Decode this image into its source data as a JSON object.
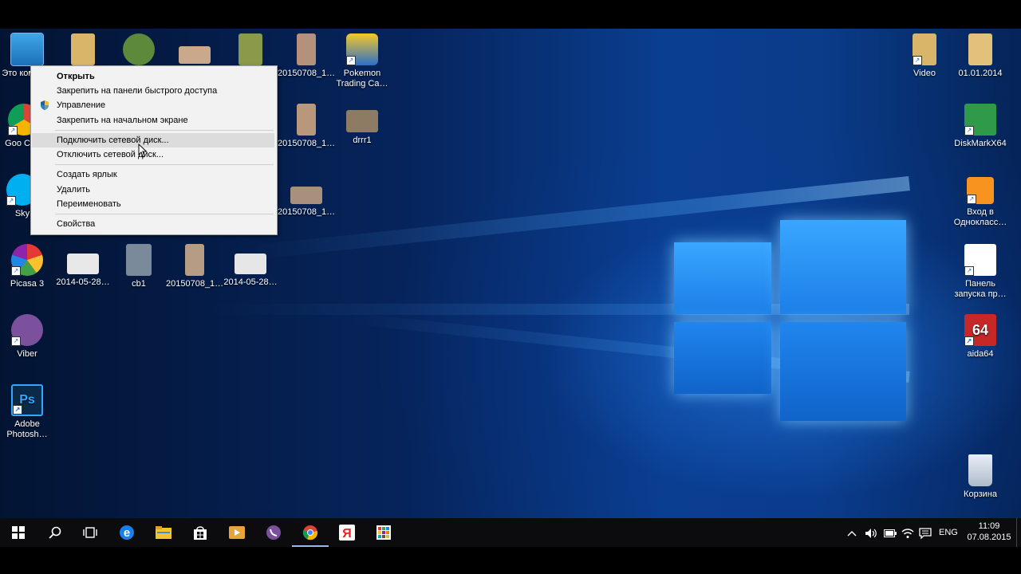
{
  "desktop": {
    "left_icons": [
      {
        "name": "this-pc-icon",
        "label": "Этот компьютер",
        "label_visible": "Это компь…",
        "type": "pc"
      },
      {
        "name": "chrome-desktop-icon",
        "label": "Google Chrome",
        "label_visible": "Goo Chro",
        "type": "chrome"
      },
      {
        "name": "skype-desktop-icon",
        "label": "Skype",
        "label_visible": "Sky",
        "type": "skype"
      },
      {
        "name": "picasa-desktop-icon",
        "label": "Picasa 3",
        "type": "picasa"
      },
      {
        "name": "viber-desktop-icon",
        "label": "Viber",
        "type": "viber"
      },
      {
        "name": "photoshop-desktop-icon",
        "label": "Adobe Photosh…",
        "type": "ps"
      }
    ],
    "file_icons": [
      {
        "label": "20150708_1…"
      },
      {
        "label": "Pokemon Trading Ca…"
      },
      {
        "label": "20150708_1…"
      },
      {
        "label": "drrr1"
      },
      {
        "label": "20150708_1…"
      },
      {
        "label": "2014-05-28…"
      },
      {
        "label": "cb1"
      },
      {
        "label": "20150708_1…"
      },
      {
        "label": "2014-05-28…"
      }
    ],
    "right_icons": [
      {
        "label": "Video"
      },
      {
        "label": "01.01.2014"
      },
      {
        "label": "DiskMarkX64"
      },
      {
        "label": "Вход в Однокласс…"
      },
      {
        "label": "Панель запуска пр…"
      },
      {
        "label": "aida64"
      },
      {
        "label": "Корзина"
      }
    ]
  },
  "context_menu": {
    "items": [
      {
        "label": "Открыть",
        "bold": true
      },
      {
        "label": "Закрепить на панели быстрого доступа"
      },
      {
        "label": "Управление",
        "icon": "shield-icon"
      },
      {
        "label": "Закрепить на начальном экране"
      },
      {
        "label": "Подключить сетевой диск...",
        "hover": true
      },
      {
        "label": "Отключить сетевой диск..."
      },
      {
        "label": "Создать ярлык"
      },
      {
        "label": "Удалить"
      },
      {
        "label": "Переименовать"
      },
      {
        "label": "Свойства"
      }
    ]
  },
  "taskbar": {
    "icons": [
      "windows-start-icon",
      "search-icon",
      "task-view-icon",
      "edge-icon",
      "file-explorer-icon",
      "store-icon",
      "media-player-icon",
      "viber-icon",
      "chrome-icon",
      "yandex-icon",
      "launcher-icon"
    ],
    "language": "ENG",
    "time": "11:09",
    "date": "07.08.2015"
  },
  "colors": {
    "accent": "#1b7fe8",
    "taskbar": "#0c0c0f",
    "menu_bg": "#f2f2f2"
  }
}
